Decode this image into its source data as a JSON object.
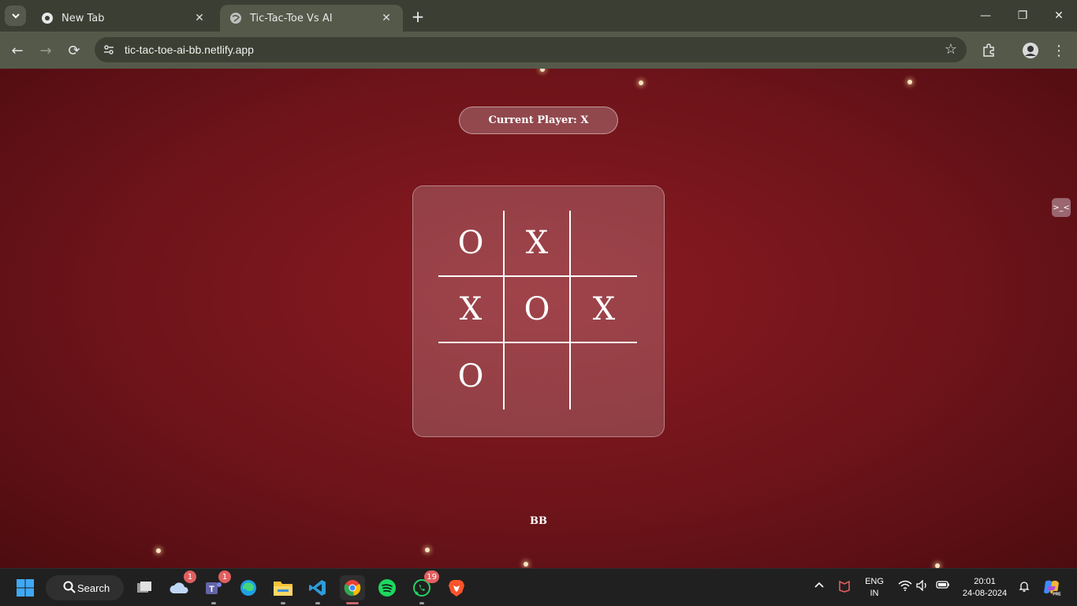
{
  "browser": {
    "tabs": [
      {
        "title": "New Tab",
        "favicon": "chrome-icon",
        "active": false
      },
      {
        "title": "Tic-Tac-Toe Vs AI",
        "favicon": "globe-icon",
        "active": true
      }
    ],
    "url": "tic-tac-toe-ai-bb.netlify.app"
  },
  "game": {
    "status": "Current Player: X",
    "board": [
      "O",
      "X",
      "",
      "X",
      "O",
      "X",
      "O",
      "",
      ""
    ],
    "footer": "BB"
  },
  "taskbar": {
    "search_label": "Search",
    "apps": [
      {
        "name": "task-view",
        "badge": ""
      },
      {
        "name": "onedrive",
        "badge": "1"
      },
      {
        "name": "teams",
        "badge": "1"
      },
      {
        "name": "edge",
        "badge": ""
      },
      {
        "name": "file-explorer",
        "badge": ""
      },
      {
        "name": "vscode",
        "badge": ""
      },
      {
        "name": "chrome",
        "badge": ""
      },
      {
        "name": "spotify",
        "badge": ""
      },
      {
        "name": "whatsapp",
        "badge": "19"
      },
      {
        "name": "brave",
        "badge": ""
      }
    ],
    "language": "ENG",
    "region": "IN",
    "time": "20:01",
    "date": "24-08-2024"
  },
  "colors": {
    "page_bg": "#7a161d",
    "accent_red": "#c9656e"
  }
}
